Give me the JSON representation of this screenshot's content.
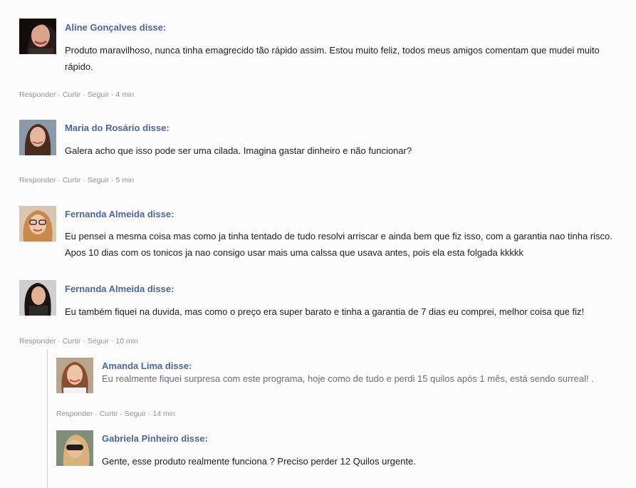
{
  "comments": [
    {
      "name": "Aline Gonçalves disse:",
      "text": "Produto maravilhoso, nunca tinha emagrecido tão rápido assim. Estou muito feliz, todos meus amigos comentam que mudei muito rápido.",
      "actions": {
        "reply": "Responder",
        "like": "Curtir",
        "follow": "Seguir",
        "time": "4 min"
      }
    },
    {
      "name": "Maria do Rosário disse:",
      "text": "Galera acho que isso pode ser uma cilada. Imagina gastar dinheiro e não funcionar?",
      "actions": {
        "reply": "Responder",
        "like": "Curtir",
        "follow": "Seguir",
        "time": "5 min"
      }
    },
    {
      "name": "Fernanda Almeida disse:",
      "text": "Eu pensei a mesma coisa mas como ja tinha tentado de tudo resolvi arriscar e ainda bem que fiz isso, com a garantia nao tinha risco. Apos 10 dias com os tonicos ja nao consigo usar mais uma calssa que usava antes, pois ela esta folgada kkkkk"
    },
    {
      "name": "Fernanda Almeida disse:",
      "text": "Eu também fiquei na duvida, mas como o preço era super barato e tinha a garantia de 7 dias eu comprei, melhor coisa que fiz!",
      "actions": {
        "reply": "Responder",
        "like": "Curtir",
        "follow": "Seguir",
        "time": "10 min"
      }
    }
  ],
  "replies": [
    {
      "name": "Amanda Lima disse:",
      "text": "Eu realmente fiquei surpresa com este programa, hoje como de tudo e perdi 15 quilos após 1 mês, está sendo surreal! .",
      "actions": {
        "reply": "Responder",
        "like": "Curtir",
        "follow": "Seguir",
        "time": "14 min"
      }
    },
    {
      "name": "Gabriela Pinheiro disse:",
      "text": "Gente, esse produto realmente funciona ? Preciso perder 12 Quilos urgente."
    }
  ],
  "separator": "·",
  "colors": {
    "name": "#4b67a1",
    "text": "#1c1e21",
    "meta": "#90949c"
  }
}
